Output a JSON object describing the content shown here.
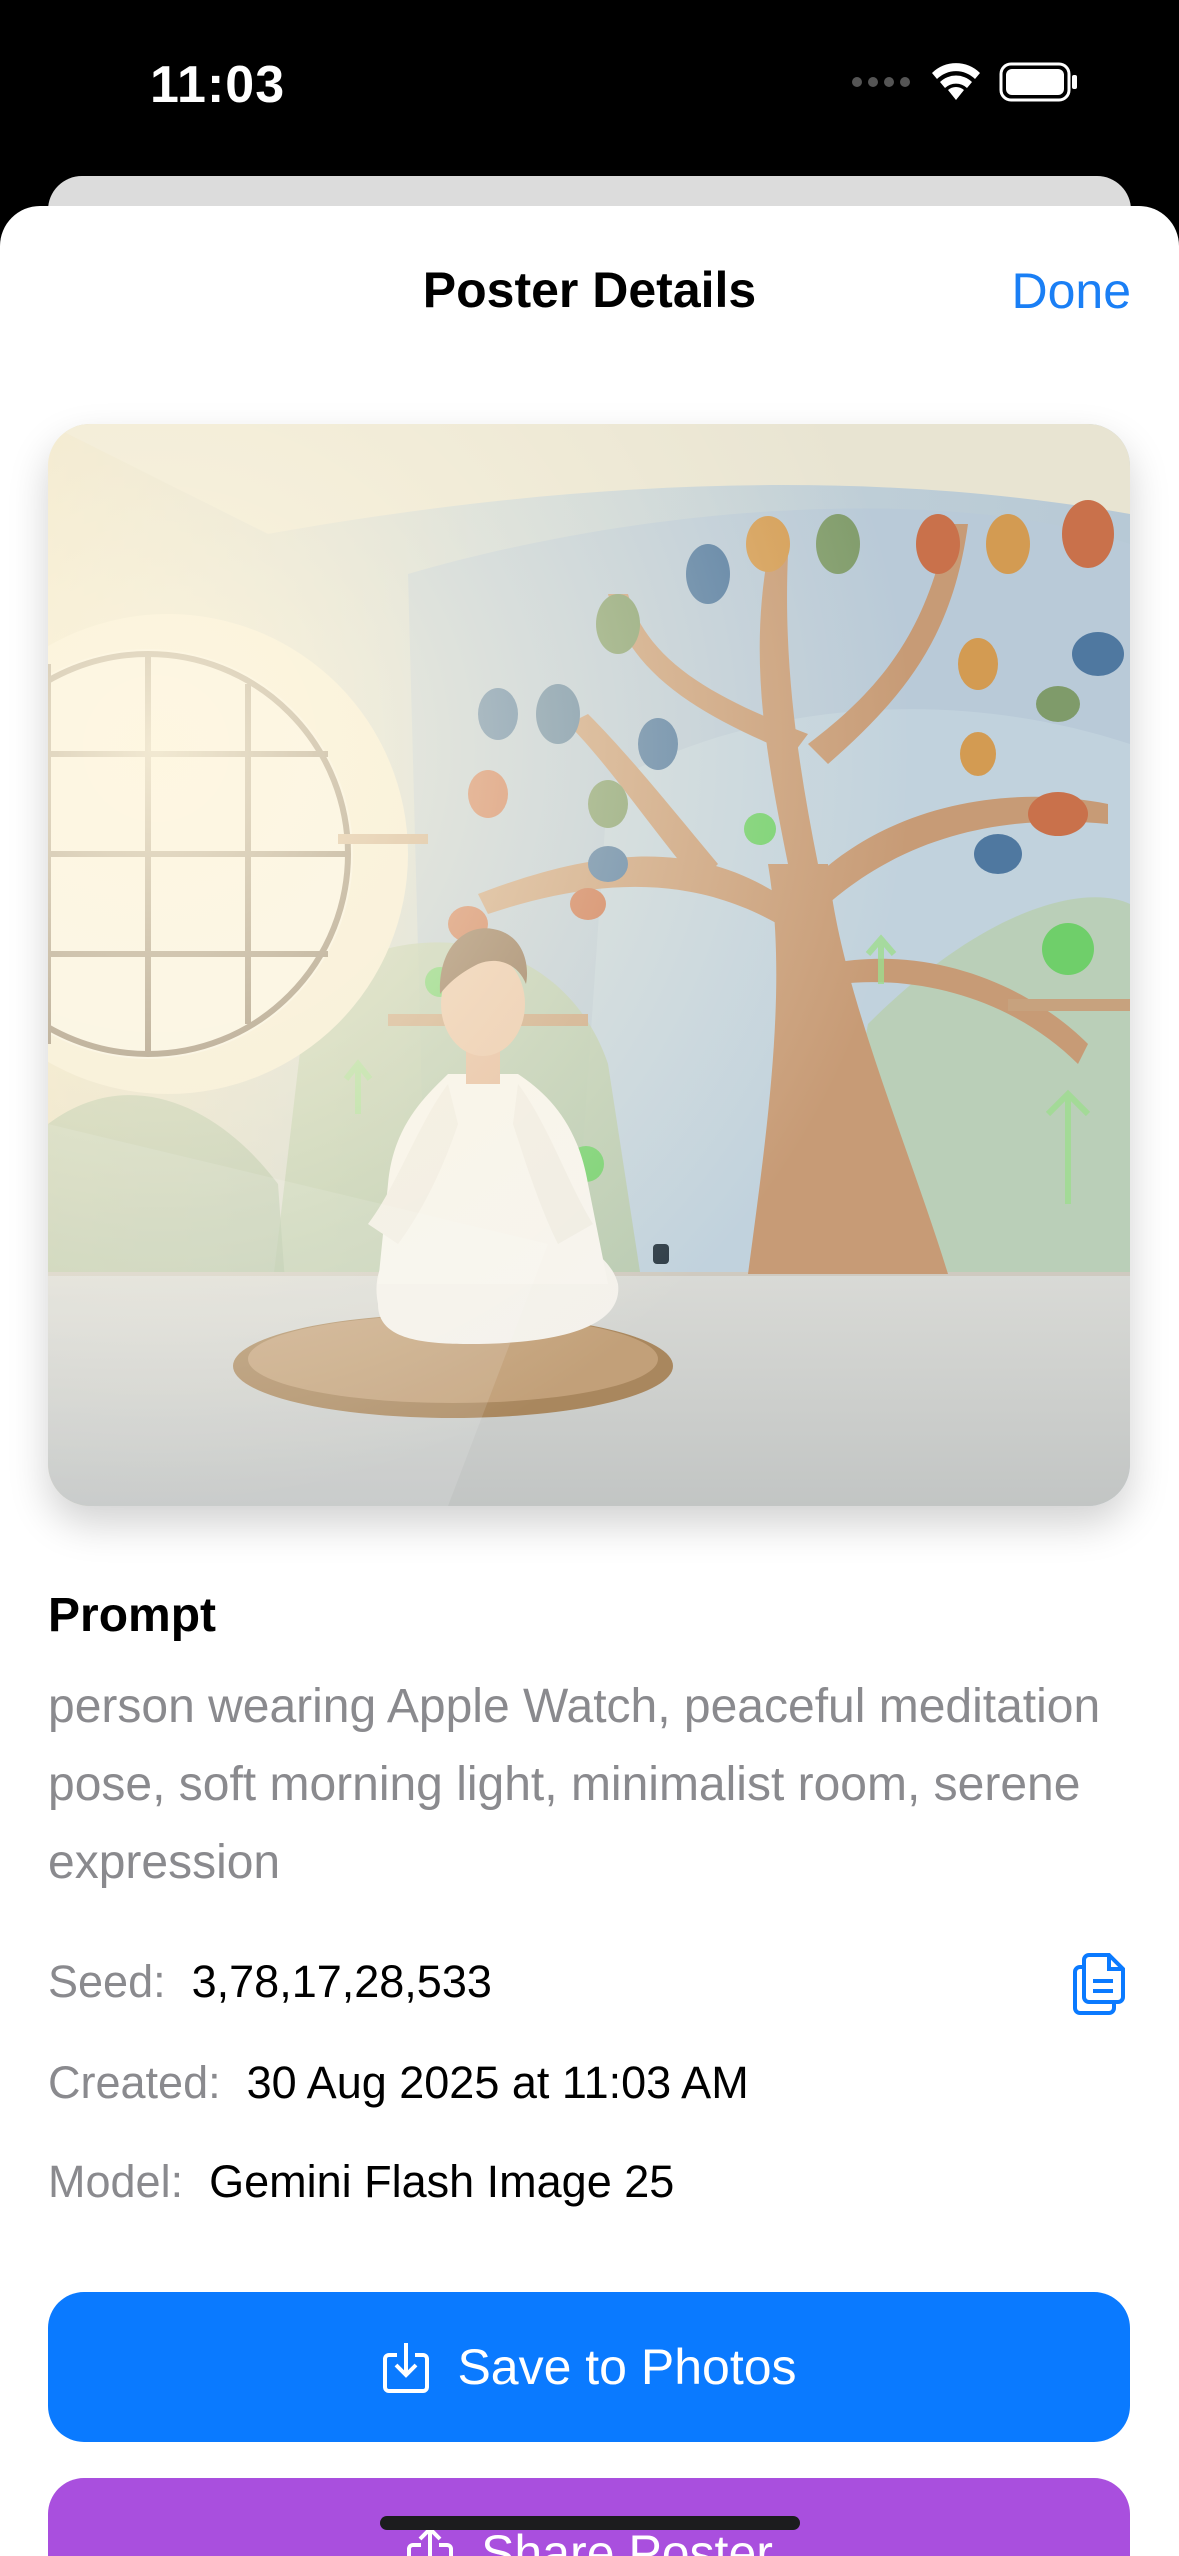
{
  "status_bar": {
    "time": "11:03"
  },
  "header": {
    "title": "Poster Details",
    "done_label": "Done"
  },
  "poster": {
    "description_icon": "meditation-poster-image"
  },
  "prompt": {
    "heading": "Prompt",
    "text": "person wearing Apple Watch, peaceful meditation pose, soft morning light, minimalist room, serene expression"
  },
  "meta": {
    "seed_label": "Seed:",
    "seed_value": "3,78,17,28,533",
    "created_label": "Created:",
    "created_value": "30 Aug 2025 at 11:03 AM",
    "model_label": "Model:",
    "model_value": "Gemini Flash Image 25"
  },
  "actions": {
    "save_label": "Save to Photos",
    "share_label": "Share Poster"
  },
  "colors": {
    "accent": "#0a7aff",
    "share": "#a94fde",
    "done": "#1a7ff5"
  }
}
